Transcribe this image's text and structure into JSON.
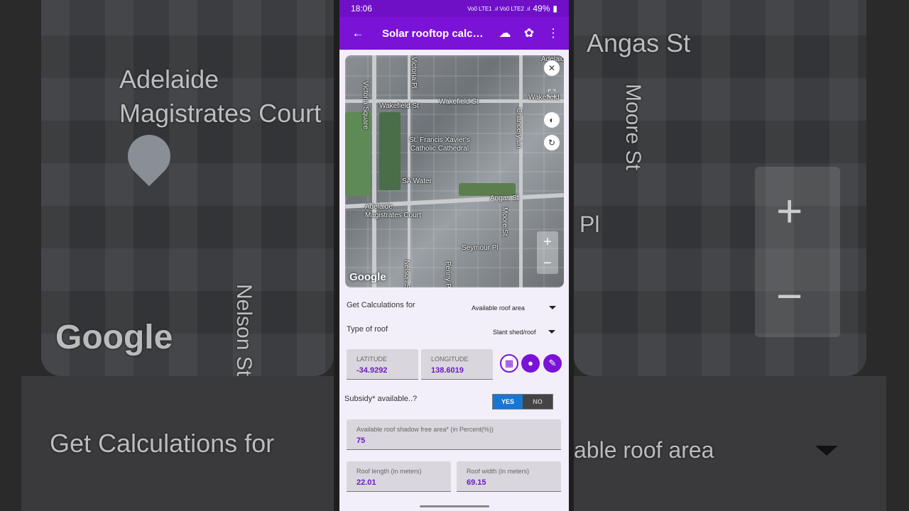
{
  "status_bar": {
    "time": "18:06",
    "battery": "49%",
    "signal": "Vo0 LTE1 .ıl Vo0 LTE2 .ıl"
  },
  "app_bar": {
    "title": "Solar rooftop calc…"
  },
  "map": {
    "labels": {
      "wakefield1": "Wakefield St",
      "wakefield2": "Wakefield St",
      "wakefield3": "Wakefield",
      "victoria_sq": "Victoria Square",
      "victoria_pl": "Victoria Pl",
      "cathedral": "St. Francis Xavier's\nCatholic Cathedral",
      "chancery": "Chancery Ln",
      "sa_water": "SA Water",
      "angas": "Angas St",
      "court": "Adelaide\nMagistrates Court",
      "moore": "Moore St",
      "seymour": "Seymour Pl",
      "nelson": "Nelson St",
      "penny": "Penny Pl",
      "adelaide_top": "Adelaide"
    },
    "attribution": "Google",
    "zoom_in": "+",
    "zoom_out": "−"
  },
  "form": {
    "calc_for_label": "Get Calculations for",
    "calc_for_value": "Available roof area",
    "roof_type_label": "Type of roof",
    "roof_type_value": "Slant shed/roof",
    "latitude_label": "LATITUDE",
    "latitude_value": "-34.9292",
    "longitude_label": "LONGITUDE",
    "longitude_value": "138.6019",
    "subsidy_label": "Subsidy* available..?",
    "subsidy_yes": "YES",
    "subsidy_no": "NO",
    "shadow_label": "Available roof shadow free area* (in Percent(%))",
    "shadow_value": "75",
    "length_label": "Roof length (in meters)",
    "length_value": "22.01",
    "width_label": "Roof width (in meters)",
    "width_value": "69.15"
  },
  "background": {
    "magistrates": "Adelaide\nMagistrates Court",
    "angas": "Angas St",
    "moore": "Moore St",
    "nelson": "Nelson St",
    "pl": "Pl",
    "google": "Google",
    "calc_for": "Get Calculations for",
    "roof_area": "able roof area"
  }
}
